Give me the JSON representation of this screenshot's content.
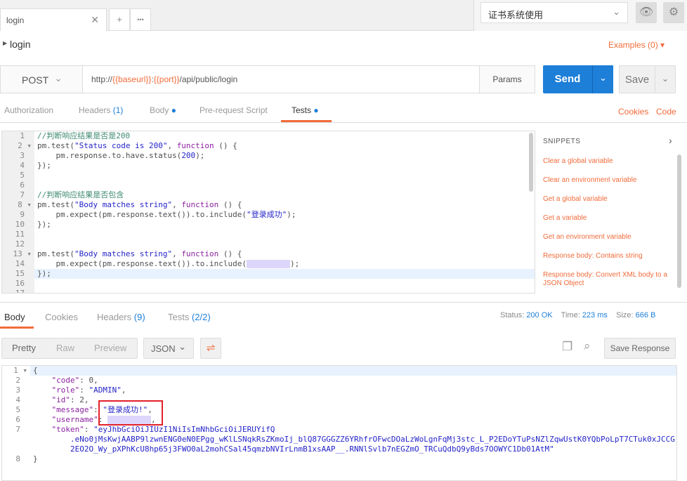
{
  "tabs": {
    "active": "login",
    "add": "+",
    "more": "•••"
  },
  "environment": {
    "selected": "证书系统使用",
    "eye_icon": "eye-icon",
    "gear_icon": "gear-icon"
  },
  "request": {
    "name": "login",
    "examples": "Examples (0)",
    "method": "POST",
    "url": {
      "prefix": "http://",
      "var1": "{{baseurl}}",
      "sep": ":",
      "var2": "{{port}}",
      "path": "/api/public/login"
    },
    "params": "Params",
    "send": "Send",
    "save": "Save"
  },
  "req_tabs": {
    "authorization": "Authorization",
    "headers": "Headers",
    "headers_count": "(1)",
    "body": "Body",
    "prerequest": "Pre-request Script",
    "tests": "Tests",
    "cookies": "Cookies",
    "code": "Code"
  },
  "editor": {
    "lines": [
      [
        {
          "t": "//判断响应结果是否是200",
          "c": "cm"
        }
      ],
      [
        {
          "t": "pm.test(",
          "c": ""
        },
        {
          "t": "\"Status code is 200\"",
          "c": "str"
        },
        {
          "t": ", ",
          "c": ""
        },
        {
          "t": "function",
          "c": "kw"
        },
        {
          "t": " () {",
          "c": ""
        }
      ],
      [
        {
          "t": "    pm.response.to.have.status(",
          "c": ""
        },
        {
          "t": "200",
          "c": "num"
        },
        {
          "t": ");",
          "c": ""
        }
      ],
      [
        {
          "t": "});",
          "c": ""
        }
      ],
      [],
      [],
      [
        {
          "t": "//判断响应结果是否包含",
          "c": "cm"
        }
      ],
      [
        {
          "t": "pm.test(",
          "c": ""
        },
        {
          "t": "\"Body matches string\"",
          "c": "str"
        },
        {
          "t": ", ",
          "c": ""
        },
        {
          "t": "function",
          "c": "kw"
        },
        {
          "t": " () {",
          "c": ""
        }
      ],
      [
        {
          "t": "    pm.expect(pm.response.text()).to.include(",
          "c": ""
        },
        {
          "t": "\"登录成功\"",
          "c": "str"
        },
        {
          "t": ");",
          "c": ""
        }
      ],
      [
        {
          "t": "});",
          "c": ""
        }
      ],
      [],
      [],
      [
        {
          "t": "pm.test(",
          "c": ""
        },
        {
          "t": "\"Body matches string\"",
          "c": "str"
        },
        {
          "t": ", ",
          "c": ""
        },
        {
          "t": "function",
          "c": "kw"
        },
        {
          "t": " () {",
          "c": ""
        }
      ],
      [
        {
          "t": "    pm.expect(pm.response.text()).to.include(",
          "c": ""
        },
        {
          "t": "BLUR",
          "c": "blur"
        },
        {
          "t": ");",
          "c": ""
        }
      ],
      [
        {
          "t": "});",
          "c": ""
        }
      ],
      [],
      []
    ]
  },
  "snippets": {
    "title": "SNIPPETS",
    "items": [
      "Clear a global variable",
      "Clear an environment variable",
      "Get a global variable",
      "Get a variable",
      "Get an environment variable",
      "Response body: Contains string",
      "Response body: Convert XML body to a JSON Object"
    ]
  },
  "response": {
    "tabs": {
      "body": "Body",
      "cookies": "Cookies",
      "headers": "Headers",
      "headers_count": "(9)",
      "tests": "Tests",
      "tests_count": "(2/2)"
    },
    "status_label": "Status:",
    "status": "200 OK",
    "time_label": "Time:",
    "time": "223 ms",
    "size_label": "Size:",
    "size": "666 B",
    "views": {
      "pretty": "Pretty",
      "raw": "Raw",
      "preview": "Preview",
      "format": "JSON"
    },
    "save_response": "Save Response",
    "lines": [
      [
        {
          "t": "{",
          "c": ""
        }
      ],
      [
        {
          "t": "    \"code\"",
          "c": "kw"
        },
        {
          "t": ": 0,",
          "c": ""
        }
      ],
      [
        {
          "t": "    \"role\"",
          "c": "kw"
        },
        {
          "t": ": ",
          "c": ""
        },
        {
          "t": "\"ADMIN\"",
          "c": "str"
        },
        {
          "t": ",",
          "c": ""
        }
      ],
      [
        {
          "t": "    \"id\"",
          "c": "kw"
        },
        {
          "t": ": 2,",
          "c": ""
        }
      ],
      [
        {
          "t": "    \"message\"",
          "c": "kw"
        },
        {
          "t": ": ",
          "c": ""
        },
        {
          "t": "\"登录成功!\"",
          "c": "str"
        },
        {
          "t": ",",
          "c": ""
        }
      ],
      [
        {
          "t": "    \"username\"",
          "c": "kw"
        },
        {
          "t": ": ",
          "c": ""
        },
        {
          "t": "BLUR",
          "c": "blur"
        },
        {
          "t": ",",
          "c": ""
        }
      ],
      [
        {
          "t": "    \"token\"",
          "c": "kw"
        },
        {
          "t": ": ",
          "c": ""
        },
        {
          "t": "\"eyJhbGciOiJIUzI1NiIsImNhbGciOiJERUYifQ",
          "c": "str"
        }
      ],
      [
        {
          "t": "        .eNo0jMsKwjAABP9lzwnENG0eN0EPgg_wKlLSNqkRsZKmoIj_blQ87GGGZZ6YRhfrOFwcDOaLzWoLgnFqMj3stc_L_P2EDoYTuPsNZlZqwUstK0YQbPoLpT7CTuk0xJCCG",
          "c": "str"
        }
      ],
      [
        {
          "t": "        2EO2O_Wy_pXPhKcU8hp65j3FWO0aL2mohCSal45qmzbNVIrLnmB1xsAAP__.RNNlSvlb7nEGZmO_TRCuQdbQ9yBds7OOWYC1Db01AtM\"",
          "c": "str"
        }
      ],
      [
        {
          "t": "}",
          "c": ""
        }
      ]
    ],
    "line_numbers": [
      "1",
      "2",
      "3",
      "4",
      "5",
      "6",
      "7",
      "",
      "",
      "8"
    ]
  },
  "colors": {
    "accent": "#f26b3a",
    "send": "#1d7fd8",
    "highlight": "#e3202a"
  }
}
